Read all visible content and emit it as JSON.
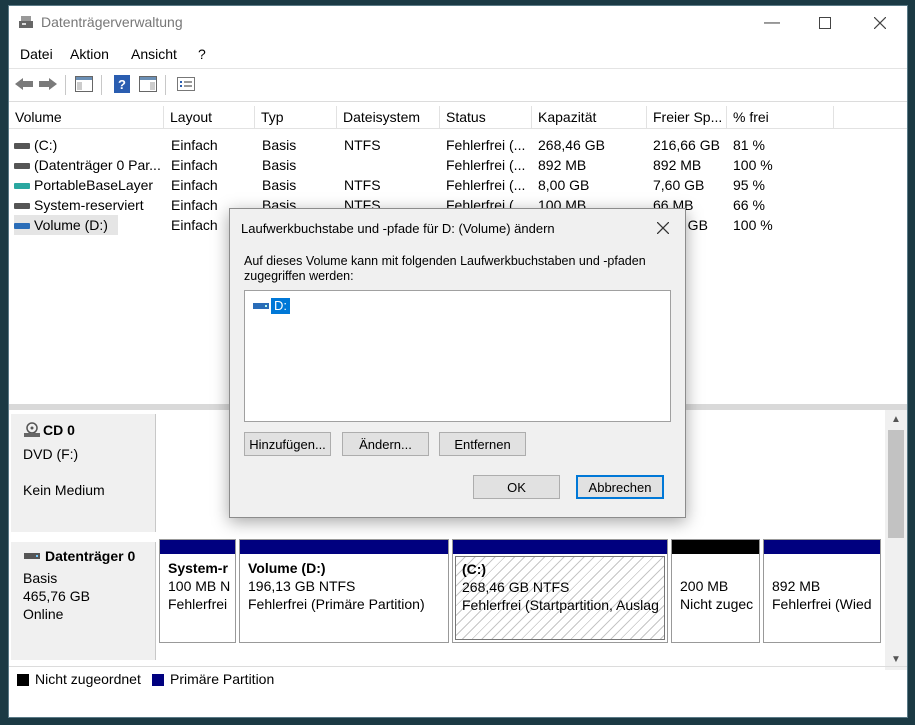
{
  "window": {
    "title": "Datenträgerverwaltung"
  },
  "menu": [
    "Datei",
    "Aktion",
    "Ansicht",
    "?"
  ],
  "volume_list": {
    "columns": [
      "Volume",
      "Layout",
      "Typ",
      "Dateisystem",
      "Status",
      "Kapazität",
      "Freier Sp...",
      "% frei"
    ],
    "rows": [
      [
        "(C:)",
        "Einfach",
        "Basis",
        "NTFS",
        "Fehlerfrei (...",
        "268,46 GB",
        "216,66 GB",
        "81 %"
      ],
      [
        "(Datenträger 0 Par...",
        "Einfach",
        "Basis",
        "",
        "Fehlerfrei (...",
        "892 MB",
        "892 MB",
        "100 %"
      ],
      [
        "PortableBaseLayer",
        "Einfach",
        "Basis",
        "NTFS",
        "Fehlerfrei (...",
        "8,00 GB",
        "7,60 GB",
        "95 %"
      ],
      [
        "System-reserviert",
        "Einfach",
        "Basis",
        "NTFS",
        "Fehlerfrei (...",
        "100 MB",
        "66 MB",
        "66 %"
      ],
      [
        "Volume (D:)",
        "Einfach",
        "",
        "",
        "",
        "",
        "3 GB",
        "100 %"
      ]
    ]
  },
  "disks": {
    "cd0": {
      "name": "CD 0",
      "drive": "DVD (F:)",
      "status": "Kein Medium"
    },
    "disk0": {
      "name": "Datenträger 0",
      "type": "Basis",
      "size": "465,76 GB",
      "status": "Online",
      "partitions": [
        {
          "name": "System-r",
          "size": "100 MB N",
          "status": "Fehlerfrei",
          "bar_color": "#00007f"
        },
        {
          "name": "Volume  (D:)",
          "size": "196,13 GB NTFS",
          "status": "Fehlerfrei (Primäre Partition)",
          "bar_color": "#00007f"
        },
        {
          "name": " (C:)",
          "size": "268,46 GB NTFS",
          "status": "Fehlerfrei (Startpartition, Auslag",
          "bar_color": "#00007f"
        },
        {
          "name": "",
          "size": "200 MB",
          "status": "Nicht zugec",
          "bar_color": "#000000"
        },
        {
          "name": "",
          "size": "892 MB",
          "status": "Fehlerfrei (Wied",
          "bar_color": "#00007f"
        }
      ]
    }
  },
  "legend": [
    {
      "label": "Nicht zugeordnet",
      "color": "#000000"
    },
    {
      "label": "Primäre Partition",
      "color": "#00007f"
    }
  ],
  "dialog": {
    "title": "Laufwerkbuchstabe und -pfade für D: (Volume) ändern",
    "description": "Auf dieses Volume kann mit folgenden Laufwerkbuchstaben und -pfaden zugegriffen werden:",
    "items": [
      "D:"
    ],
    "buttons": {
      "add": "Hinzufügen...",
      "change": "Ändern...",
      "remove": "Entfernen",
      "ok": "OK",
      "cancel": "Abbrechen"
    }
  },
  "colors": {
    "selection": "#0078d7",
    "primary_partition": "#00007f",
    "unallocated": "#000000"
  }
}
